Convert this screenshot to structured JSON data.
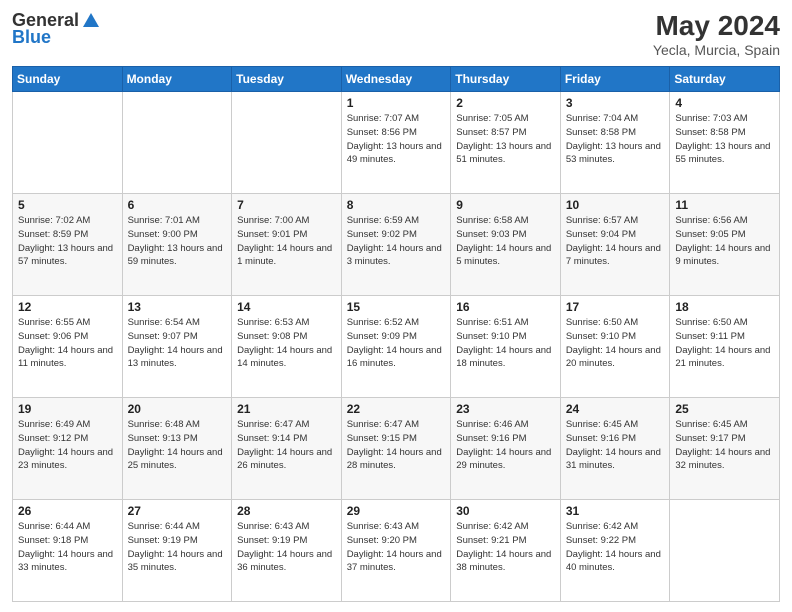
{
  "header": {
    "logo_general": "General",
    "logo_blue": "Blue",
    "month": "May 2024",
    "location": "Yecla, Murcia, Spain"
  },
  "weekdays": [
    "Sunday",
    "Monday",
    "Tuesday",
    "Wednesday",
    "Thursday",
    "Friday",
    "Saturday"
  ],
  "weeks": [
    [
      {
        "day": "",
        "sunrise": "",
        "sunset": "",
        "daylight": ""
      },
      {
        "day": "",
        "sunrise": "",
        "sunset": "",
        "daylight": ""
      },
      {
        "day": "",
        "sunrise": "",
        "sunset": "",
        "daylight": ""
      },
      {
        "day": "1",
        "sunrise": "Sunrise: 7:07 AM",
        "sunset": "Sunset: 8:56 PM",
        "daylight": "Daylight: 13 hours and 49 minutes."
      },
      {
        "day": "2",
        "sunrise": "Sunrise: 7:05 AM",
        "sunset": "Sunset: 8:57 PM",
        "daylight": "Daylight: 13 hours and 51 minutes."
      },
      {
        "day": "3",
        "sunrise": "Sunrise: 7:04 AM",
        "sunset": "Sunset: 8:58 PM",
        "daylight": "Daylight: 13 hours and 53 minutes."
      },
      {
        "day": "4",
        "sunrise": "Sunrise: 7:03 AM",
        "sunset": "Sunset: 8:58 PM",
        "daylight": "Daylight: 13 hours and 55 minutes."
      }
    ],
    [
      {
        "day": "5",
        "sunrise": "Sunrise: 7:02 AM",
        "sunset": "Sunset: 8:59 PM",
        "daylight": "Daylight: 13 hours and 57 minutes."
      },
      {
        "day": "6",
        "sunrise": "Sunrise: 7:01 AM",
        "sunset": "Sunset: 9:00 PM",
        "daylight": "Daylight: 13 hours and 59 minutes."
      },
      {
        "day": "7",
        "sunrise": "Sunrise: 7:00 AM",
        "sunset": "Sunset: 9:01 PM",
        "daylight": "Daylight: 14 hours and 1 minute."
      },
      {
        "day": "8",
        "sunrise": "Sunrise: 6:59 AM",
        "sunset": "Sunset: 9:02 PM",
        "daylight": "Daylight: 14 hours and 3 minutes."
      },
      {
        "day": "9",
        "sunrise": "Sunrise: 6:58 AM",
        "sunset": "Sunset: 9:03 PM",
        "daylight": "Daylight: 14 hours and 5 minutes."
      },
      {
        "day": "10",
        "sunrise": "Sunrise: 6:57 AM",
        "sunset": "Sunset: 9:04 PM",
        "daylight": "Daylight: 14 hours and 7 minutes."
      },
      {
        "day": "11",
        "sunrise": "Sunrise: 6:56 AM",
        "sunset": "Sunset: 9:05 PM",
        "daylight": "Daylight: 14 hours and 9 minutes."
      }
    ],
    [
      {
        "day": "12",
        "sunrise": "Sunrise: 6:55 AM",
        "sunset": "Sunset: 9:06 PM",
        "daylight": "Daylight: 14 hours and 11 minutes."
      },
      {
        "day": "13",
        "sunrise": "Sunrise: 6:54 AM",
        "sunset": "Sunset: 9:07 PM",
        "daylight": "Daylight: 14 hours and 13 minutes."
      },
      {
        "day": "14",
        "sunrise": "Sunrise: 6:53 AM",
        "sunset": "Sunset: 9:08 PM",
        "daylight": "Daylight: 14 hours and 14 minutes."
      },
      {
        "day": "15",
        "sunrise": "Sunrise: 6:52 AM",
        "sunset": "Sunset: 9:09 PM",
        "daylight": "Daylight: 14 hours and 16 minutes."
      },
      {
        "day": "16",
        "sunrise": "Sunrise: 6:51 AM",
        "sunset": "Sunset: 9:10 PM",
        "daylight": "Daylight: 14 hours and 18 minutes."
      },
      {
        "day": "17",
        "sunrise": "Sunrise: 6:50 AM",
        "sunset": "Sunset: 9:10 PM",
        "daylight": "Daylight: 14 hours and 20 minutes."
      },
      {
        "day": "18",
        "sunrise": "Sunrise: 6:50 AM",
        "sunset": "Sunset: 9:11 PM",
        "daylight": "Daylight: 14 hours and 21 minutes."
      }
    ],
    [
      {
        "day": "19",
        "sunrise": "Sunrise: 6:49 AM",
        "sunset": "Sunset: 9:12 PM",
        "daylight": "Daylight: 14 hours and 23 minutes."
      },
      {
        "day": "20",
        "sunrise": "Sunrise: 6:48 AM",
        "sunset": "Sunset: 9:13 PM",
        "daylight": "Daylight: 14 hours and 25 minutes."
      },
      {
        "day": "21",
        "sunrise": "Sunrise: 6:47 AM",
        "sunset": "Sunset: 9:14 PM",
        "daylight": "Daylight: 14 hours and 26 minutes."
      },
      {
        "day": "22",
        "sunrise": "Sunrise: 6:47 AM",
        "sunset": "Sunset: 9:15 PM",
        "daylight": "Daylight: 14 hours and 28 minutes."
      },
      {
        "day": "23",
        "sunrise": "Sunrise: 6:46 AM",
        "sunset": "Sunset: 9:16 PM",
        "daylight": "Daylight: 14 hours and 29 minutes."
      },
      {
        "day": "24",
        "sunrise": "Sunrise: 6:45 AM",
        "sunset": "Sunset: 9:16 PM",
        "daylight": "Daylight: 14 hours and 31 minutes."
      },
      {
        "day": "25",
        "sunrise": "Sunrise: 6:45 AM",
        "sunset": "Sunset: 9:17 PM",
        "daylight": "Daylight: 14 hours and 32 minutes."
      }
    ],
    [
      {
        "day": "26",
        "sunrise": "Sunrise: 6:44 AM",
        "sunset": "Sunset: 9:18 PM",
        "daylight": "Daylight: 14 hours and 33 minutes."
      },
      {
        "day": "27",
        "sunrise": "Sunrise: 6:44 AM",
        "sunset": "Sunset: 9:19 PM",
        "daylight": "Daylight: 14 hours and 35 minutes."
      },
      {
        "day": "28",
        "sunrise": "Sunrise: 6:43 AM",
        "sunset": "Sunset: 9:19 PM",
        "daylight": "Daylight: 14 hours and 36 minutes."
      },
      {
        "day": "29",
        "sunrise": "Sunrise: 6:43 AM",
        "sunset": "Sunset: 9:20 PM",
        "daylight": "Daylight: 14 hours and 37 minutes."
      },
      {
        "day": "30",
        "sunrise": "Sunrise: 6:42 AM",
        "sunset": "Sunset: 9:21 PM",
        "daylight": "Daylight: 14 hours and 38 minutes."
      },
      {
        "day": "31",
        "sunrise": "Sunrise: 6:42 AM",
        "sunset": "Sunset: 9:22 PM",
        "daylight": "Daylight: 14 hours and 40 minutes."
      },
      {
        "day": "",
        "sunrise": "",
        "sunset": "",
        "daylight": ""
      }
    ]
  ]
}
